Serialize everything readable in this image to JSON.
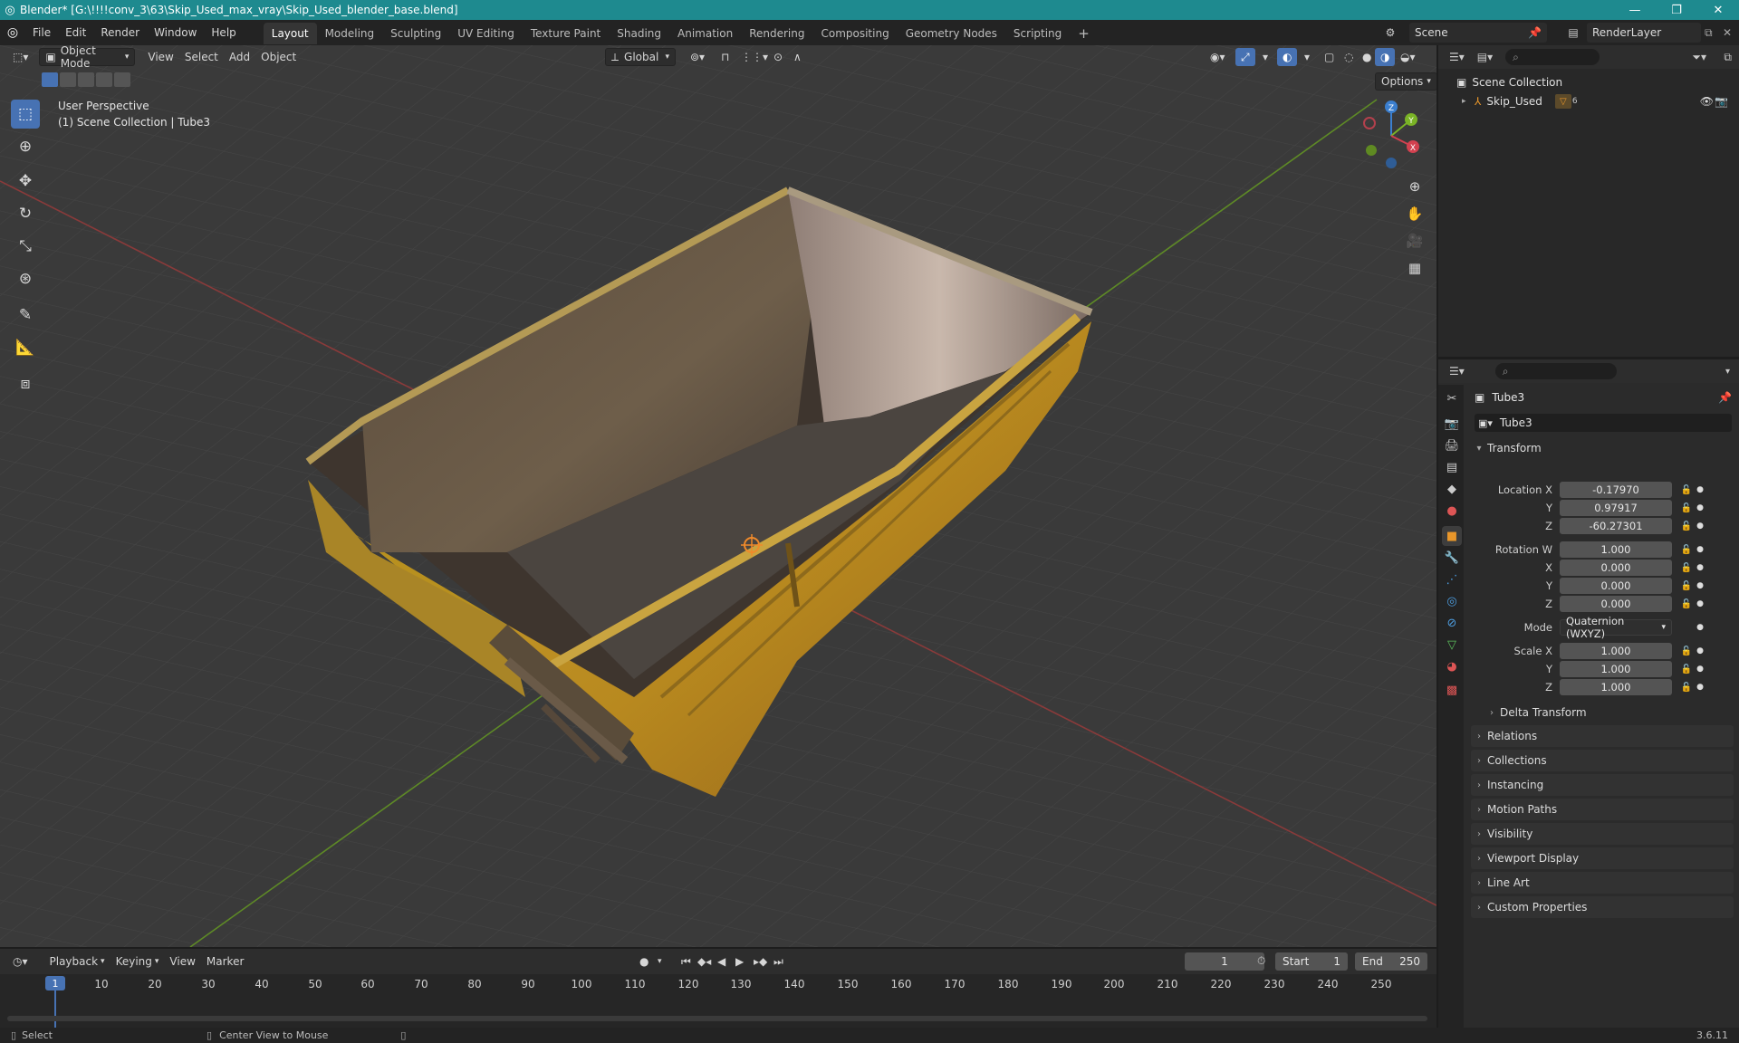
{
  "window": {
    "title": "Blender* [G:\\!!!!conv_3\\63\\Skip_Used_max_vray\\Skip_Used_blender_base.blend]",
    "minimize": "—",
    "maximize": "❐",
    "close": "✕"
  },
  "menu": [
    "File",
    "Edit",
    "Render",
    "Window",
    "Help"
  ],
  "workspaces": [
    {
      "label": "Layout",
      "active": true
    },
    {
      "label": "Modeling"
    },
    {
      "label": "Sculpting"
    },
    {
      "label": "UV Editing"
    },
    {
      "label": "Texture Paint"
    },
    {
      "label": "Shading"
    },
    {
      "label": "Animation"
    },
    {
      "label": "Rendering"
    },
    {
      "label": "Compositing"
    },
    {
      "label": "Geometry Nodes"
    },
    {
      "label": "Scripting"
    }
  ],
  "workspace_add": "+",
  "scene": {
    "name": "Scene",
    "render_layer": "RenderLayer"
  },
  "viewport": {
    "mode": "Object Mode",
    "menus": [
      "View",
      "Select",
      "Add",
      "Object"
    ],
    "orientation": "Global",
    "options_label": "Options",
    "overlay_title": "User Perspective",
    "overlay_subtitle": "(1) Scene Collection | Tube3",
    "gizmo": {
      "z": "Z",
      "y": "Y",
      "x": "X"
    }
  },
  "outliner": {
    "root": "Scene Collection",
    "items": [
      {
        "label": "Skip_Used",
        "badge": "6"
      }
    ]
  },
  "properties": {
    "object_name": "Tube3",
    "data_name": "Tube3",
    "transform_label": "Transform",
    "location": {
      "label": "Location X",
      "x": "-0.17970",
      "y": "0.97917",
      "z": "-60.27301"
    },
    "rotation": {
      "label": "Rotation W",
      "w": "1.000",
      "x": "0.000",
      "y": "0.000",
      "z": "0.000"
    },
    "mode_label": "Mode",
    "mode_value": "Quaternion (WXYZ)",
    "scale": {
      "label": "Scale X",
      "x": "1.000",
      "y": "1.000",
      "z": "1.000"
    },
    "axis_labels": {
      "y": "Y",
      "z": "Z",
      "x": "X"
    },
    "delta_transform": "Delta Transform",
    "sections": [
      "Relations",
      "Collections",
      "Instancing",
      "Motion Paths",
      "Visibility",
      "Viewport Display",
      "Line Art",
      "Custom Properties"
    ]
  },
  "timeline": {
    "menus": [
      "Playback",
      "Keying",
      "View",
      "Marker"
    ],
    "current_frame": "1",
    "start_label": "Start",
    "start": "1",
    "end_label": "End",
    "end": "250",
    "ticks": [
      "10",
      "20",
      "30",
      "40",
      "50",
      "60",
      "70",
      "80",
      "90",
      "100",
      "110",
      "120",
      "130",
      "140",
      "150",
      "160",
      "170",
      "180",
      "190",
      "200",
      "210",
      "220",
      "230",
      "240",
      "250"
    ],
    "playhead": "1"
  },
  "status": {
    "select": "Select",
    "center_view": "Center View to Mouse",
    "version": "3.6.11"
  }
}
